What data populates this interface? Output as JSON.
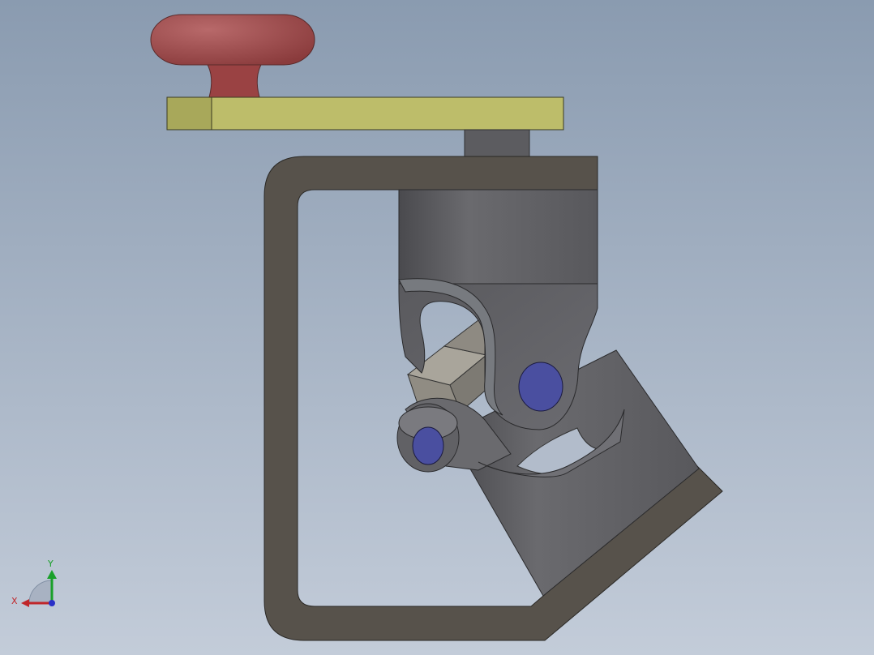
{
  "viewport": {
    "background_top": "#8a9bb0",
    "background_bottom": "#c3ccd9"
  },
  "model": {
    "knob_color": "#a0494a",
    "plate_color": "#bdbd6a",
    "bracket_color": "#57524b",
    "shaft_color": "#5e5e62",
    "pin_color": "#4a4fa0"
  },
  "triad": {
    "x_label": "X",
    "y_label": "Y",
    "x_color": "#c0262a",
    "y_color": "#1aa02a",
    "z_color": "#2a30c8"
  }
}
